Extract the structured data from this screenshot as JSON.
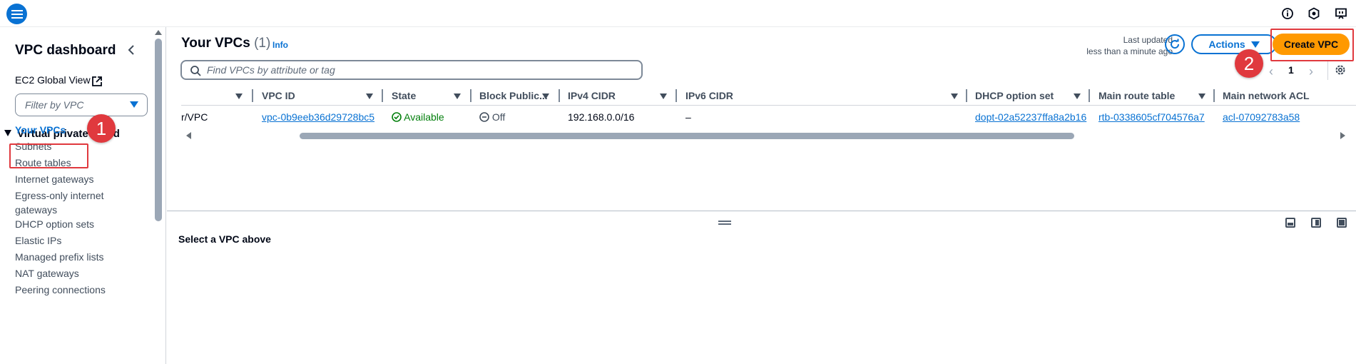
{
  "sidebar": {
    "title": "VPC dashboard",
    "global_view": "EC2 Global View",
    "filter_placeholder": "Filter by VPC",
    "section": "Virtual private cloud",
    "items": [
      "Your VPCs",
      "Subnets",
      "Route tables",
      "Internet gateways",
      "Egress-only internet gateways",
      "DHCP option sets",
      "Elastic IPs",
      "Managed prefix lists",
      "NAT gateways",
      "Peering connections"
    ]
  },
  "annotations": {
    "badge1": "1",
    "badge2": "2"
  },
  "main": {
    "title": "Your VPCs",
    "count": "(1)",
    "info": "Info",
    "last_updated_label": "Last updated",
    "last_updated_value": "less than a minute ago",
    "actions_label": "Actions",
    "create_label": "Create VPC",
    "search_placeholder": "Find VPCs by attribute or tag",
    "page": "1",
    "columns": [
      "VPC ID",
      "State",
      "Block Public...",
      "IPv4 CIDR",
      "IPv6 CIDR",
      "DHCP option set",
      "Main route table",
      "Main network ACL"
    ],
    "row": {
      "name": "r/VPC",
      "vpc_id": "vpc-0b9eeb36d29728bc5",
      "state": "Available",
      "block_public": "Off",
      "ipv4": "192.168.0.0/16",
      "ipv6": "–",
      "dhcp": "dopt-02a52237ffa8a2b16",
      "route_table": "rtb-0338605cf704576a7",
      "acl": "acl-07092783a58"
    },
    "empty_detail": "Select a VPC above"
  },
  "colors": {
    "accent": "#0972d3",
    "primary_button": "#ff9900",
    "annotation": "#e0393e",
    "success": "#037f0c"
  }
}
